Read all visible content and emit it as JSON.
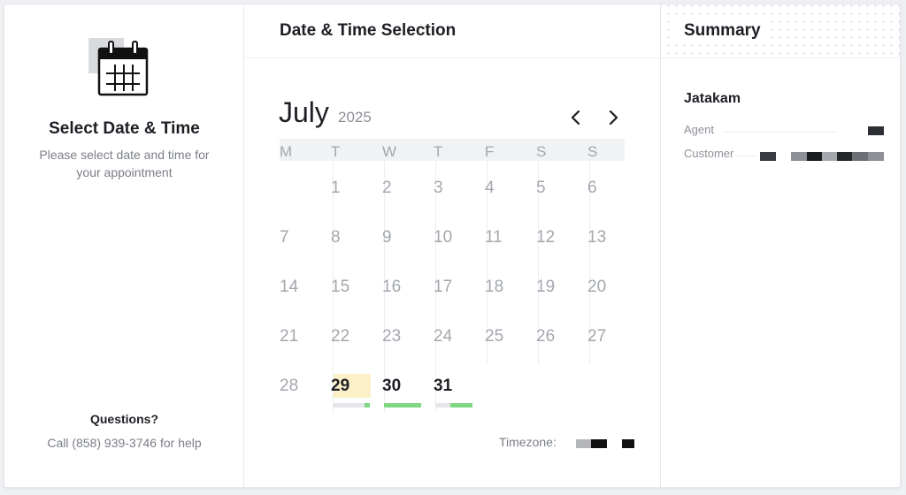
{
  "left": {
    "title": "Select Date & Time",
    "subtitle": "Please select date and time for your appointment",
    "questions_heading": "Questions?",
    "call_text": "Call (858) 939-3746 for help",
    "icon": "calendar-icon"
  },
  "middle": {
    "header_title": "Date & Time Selection",
    "month": "July",
    "year": "2025",
    "prev_icon": "chevron-left-icon",
    "next_icon": "chevron-right-icon",
    "weekdays": [
      "M",
      "T",
      "W",
      "T",
      "F",
      "S",
      "S"
    ],
    "weeks": [
      [
        "",
        "1",
        "2",
        "3",
        "4",
        "5",
        "6"
      ],
      [
        "7",
        "8",
        "9",
        "10",
        "11",
        "12",
        "13"
      ],
      [
        "14",
        "15",
        "16",
        "17",
        "18",
        "19",
        "20"
      ],
      [
        "21",
        "22",
        "23",
        "24",
        "25",
        "26",
        "27"
      ],
      [
        "28",
        "29",
        "30",
        "31",
        "",
        "",
        ""
      ]
    ],
    "available_days": [
      {
        "day": "29",
        "selected": true,
        "availability": 0.15
      },
      {
        "day": "30",
        "selected": false,
        "availability": 1.0
      },
      {
        "day": "31",
        "selected": false,
        "availability": 0.6
      }
    ],
    "timezone_label": "Timezone:"
  },
  "summary": {
    "title": "Summary",
    "name": "Jatakam",
    "agent_label": "Agent",
    "customer_label": "Customer"
  },
  "colors": {
    "availability_green": "#7fd683",
    "selected_highlight": "#fbf0c7",
    "muted_text": "#a3a7ad",
    "dark_text": "#1d1f24"
  }
}
